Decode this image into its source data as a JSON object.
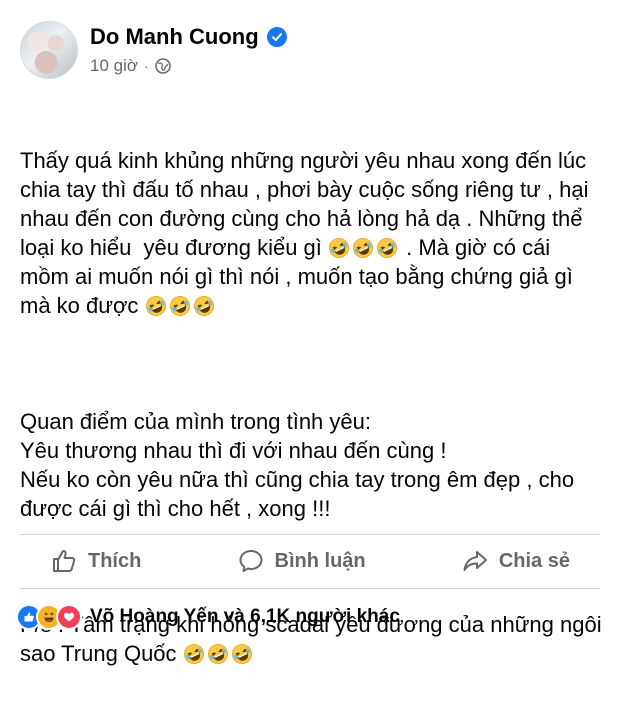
{
  "post": {
    "author": "Do Manh Cuong",
    "time": "10 giờ",
    "paragraphs": [
      "Thấy quá kinh khủng những người yêu nhau xong đến lúc chia tay thì đấu tố nhau , phơi bày cuộc sống riêng tư , hại nhau đến con đường cùng cho hả lòng hả dạ . Những thể loại ko hiểu  yêu đương kiểu gì",
      "Quan điểm của mình trong tình yêu:\nYêu thương nhau thì đi với nhau đến cùng !\nNếu ko còn yêu nữa thì cũng chia tay trong êm đẹp , cho được cái gì thì cho hết , xong !!!",
      "P/s : Tâm trạng khi hóng scadal yêu đương của những ngôi sao Trung Quốc"
    ],
    "paragraph1_tail": ". Mà giờ có cái mồm ai muốn nói gì thì nói , muốn tạo bằng chứng giả gì mà ko được",
    "emoji_name": "rolling-on-floor-laughing-emoji"
  },
  "actions": {
    "like": "Thích",
    "comment": "Bình luận",
    "share": "Chia sẻ"
  },
  "reactions": {
    "summary": "Võ Hoàng Yến và 6,1K người khác",
    "types": [
      "like",
      "haha",
      "love"
    ]
  },
  "colors": {
    "brand": "#1877f2",
    "text": "#050505",
    "muted": "#65676b"
  }
}
